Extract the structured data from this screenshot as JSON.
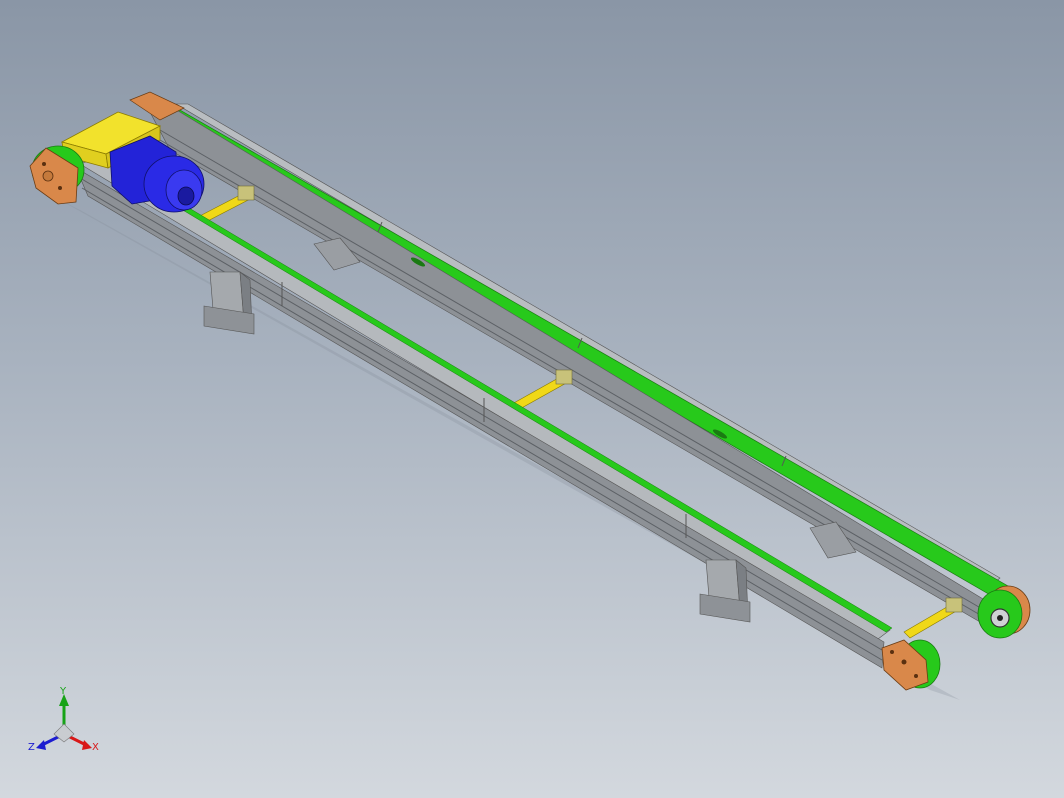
{
  "viewport": {
    "background_top": "#8a96a6",
    "background_bottom": "#d3d8de"
  },
  "model": {
    "belt_color": "#27c91b",
    "frame_color": "#a3a7ab",
    "frame_dark": "#6f7378",
    "motor_color": "#2323d8",
    "gearbox_color": "#f2e22c",
    "pulley_plate_color": "#d9884a",
    "strut_color": "#f0d818"
  },
  "triad": {
    "x_label": "X",
    "y_label": "Y",
    "z_label": "Z",
    "x_color": "#d81818",
    "y_color": "#17a317",
    "z_color": "#1c1cd0"
  }
}
